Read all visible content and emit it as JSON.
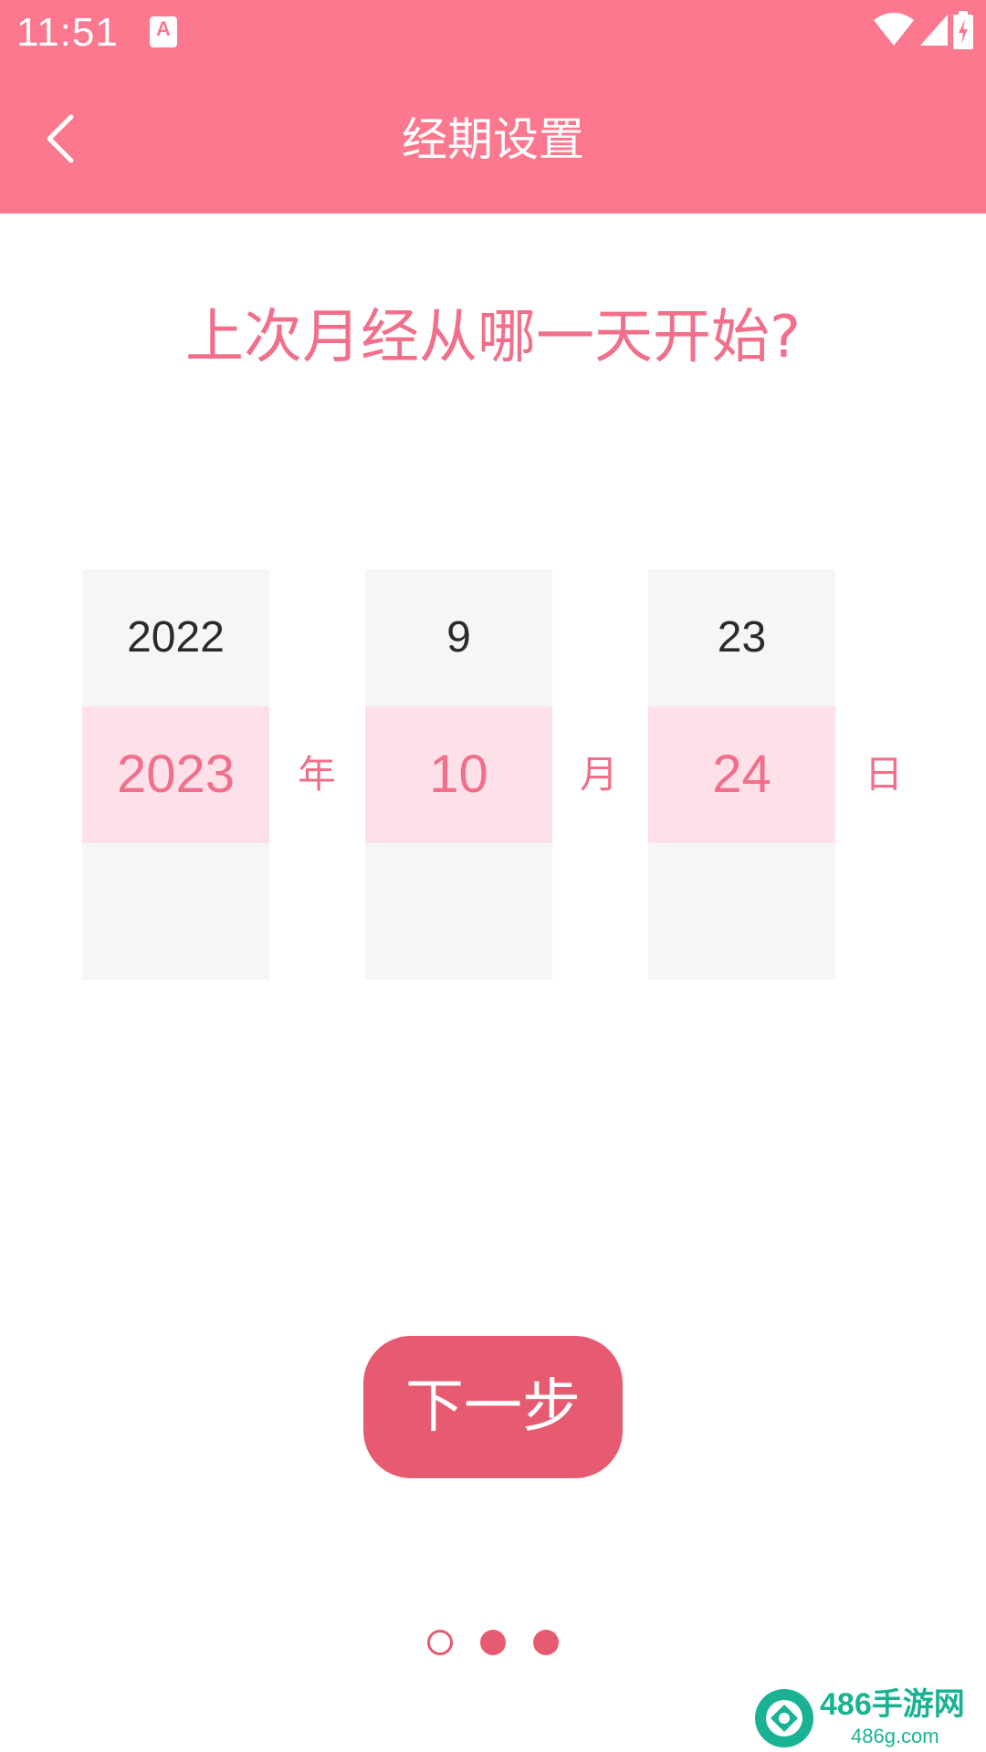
{
  "status_bar": {
    "time": "11:51",
    "app_icon_letter": "A",
    "icons": [
      "wifi-icon",
      "cell-signal-icon",
      "battery-charging-icon"
    ]
  },
  "app_bar": {
    "title": "经期设置",
    "back_icon": "chevron-left-icon"
  },
  "question": "上次月经从哪一天开始?",
  "picker": {
    "year": {
      "prev": "2022",
      "selected": "2023",
      "next": "",
      "unit": "年"
    },
    "month": {
      "prev": "9",
      "selected": "10",
      "next": "",
      "unit": "月"
    },
    "day": {
      "prev": "23",
      "selected": "24",
      "next": "",
      "unit": "日"
    }
  },
  "next_button": {
    "label": "下一步"
  },
  "page_indicator": {
    "total": 3,
    "hollow_index": 0
  },
  "watermark": {
    "brand": "486手游网",
    "url": "486g.com"
  },
  "colors": {
    "primary": "#fb788e",
    "accent": "#e75b72",
    "text_pink": "#f16f8a",
    "selected_bg": "#fde0e8",
    "picker_bg": "#f6f6f6"
  }
}
